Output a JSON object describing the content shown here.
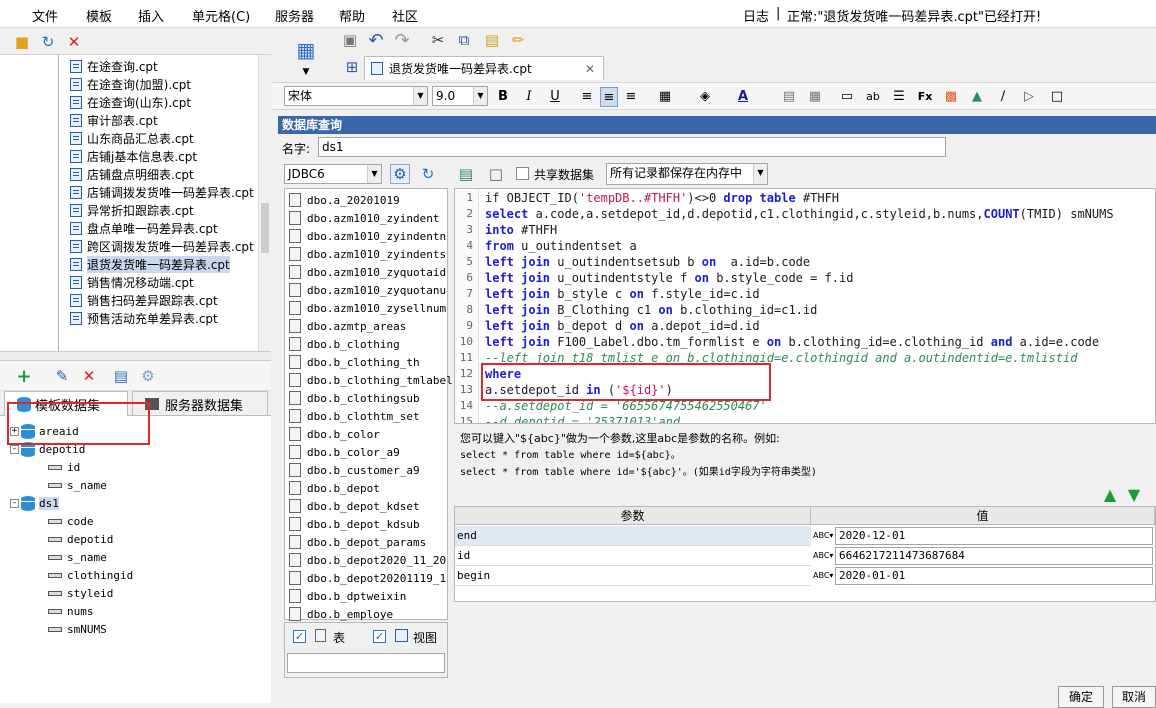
{
  "menubar": {
    "items": [
      "文件",
      "模板",
      "插入",
      "单元格(C)",
      "服务器",
      "帮助",
      "社区"
    ],
    "log_label": "日志",
    "status": "正常:\"退货发货唯一码差异表.cpt\"已经打开!"
  },
  "files": [
    "在途查询.cpt",
    "在途查询(加盟).cpt",
    "在途查询(山东).cpt",
    "审计部表.cpt",
    "山东商品汇总表.cpt",
    "店铺j基本信息表.cpt",
    "店铺盘点明细表.cpt",
    "店铺调拨发货唯一码差异表.cpt",
    "异常折扣跟踪表.cpt",
    "盘点单唯一码差异表.cpt",
    "跨区调拨发货唯一码差异表.cpt",
    "退货发货唯一码差异表.cpt",
    "销售情况移动端.cpt",
    "销售扫码差异跟踪表.cpt",
    "预售活动充单差异表.cpt"
  ],
  "dataset_tabs": {
    "template": "模板数据集",
    "server": "服务器数据集"
  },
  "dataset_tree": {
    "areaid": "areaid",
    "depotid": "depotid",
    "depotid_children": [
      "id",
      "s_name"
    ],
    "ds1": "ds1",
    "ds1_children": [
      "code",
      "depotid",
      "s_name",
      "clothingid",
      "styleid",
      "nums",
      "smNUMS"
    ]
  },
  "document_tab": "退货发货唯一码差异表.cpt",
  "format": {
    "font": "宋体",
    "size": "9.0"
  },
  "dialog": {
    "title": "数据库查询",
    "name_label": "名字:",
    "name_value": "ds1",
    "connection": "JDBC6",
    "shared_dataset": "共享数据集",
    "memory_option": "所有记录都保存在内存中",
    "tables": [
      "dbo.a_20201019",
      "dbo.azm1010_zyindent",
      "dbo.azm1010_zyindentn",
      "dbo.azm1010_zyindents",
      "dbo.azm1010_zyquotaid",
      "dbo.azm1010_zyquotanu",
      "dbo.azm1010_zysellnum",
      "dbo.azmtp_areas",
      "dbo.b_clothing",
      "dbo.b_clothing_th",
      "dbo.b_clothing_tmlabel",
      "dbo.b_clothingsub",
      "dbo.b_clothtm_set",
      "dbo.b_color",
      "dbo.b_color_a9",
      "dbo.b_customer_a9",
      "dbo.b_depot",
      "dbo.b_depot_kdset",
      "dbo.b_depot_kdsub",
      "dbo.b_depot_params",
      "dbo.b_depot2020_11_20",
      "dbo.b_depot20201119_1",
      "dbo.b_dptweixin",
      "dbo.b_employe"
    ],
    "table_check": "表",
    "view_check": "视图",
    "line_numbers": [
      "1",
      "2",
      "3",
      "4",
      "5",
      "6",
      "7",
      "8",
      "9",
      "10",
      "11",
      "12",
      "13",
      "14",
      "15"
    ],
    "help_lines": [
      "您可以键入\"${abc}\"做为一个参数,这里abc是参数的名称。例如:",
      "select * from table where id=${abc}。",
      "select * from table where id='${abc}'。(如果id字段为字符串类型)"
    ],
    "param_header": "参数",
    "value_header": "值",
    "params": [
      {
        "name": "end",
        "value": "2020-12-01"
      },
      {
        "name": "id",
        "value": "6646217211473687684"
      },
      {
        "name": "begin",
        "value": "2020-01-01"
      }
    ],
    "ok": "确定",
    "cancel": "取消"
  }
}
